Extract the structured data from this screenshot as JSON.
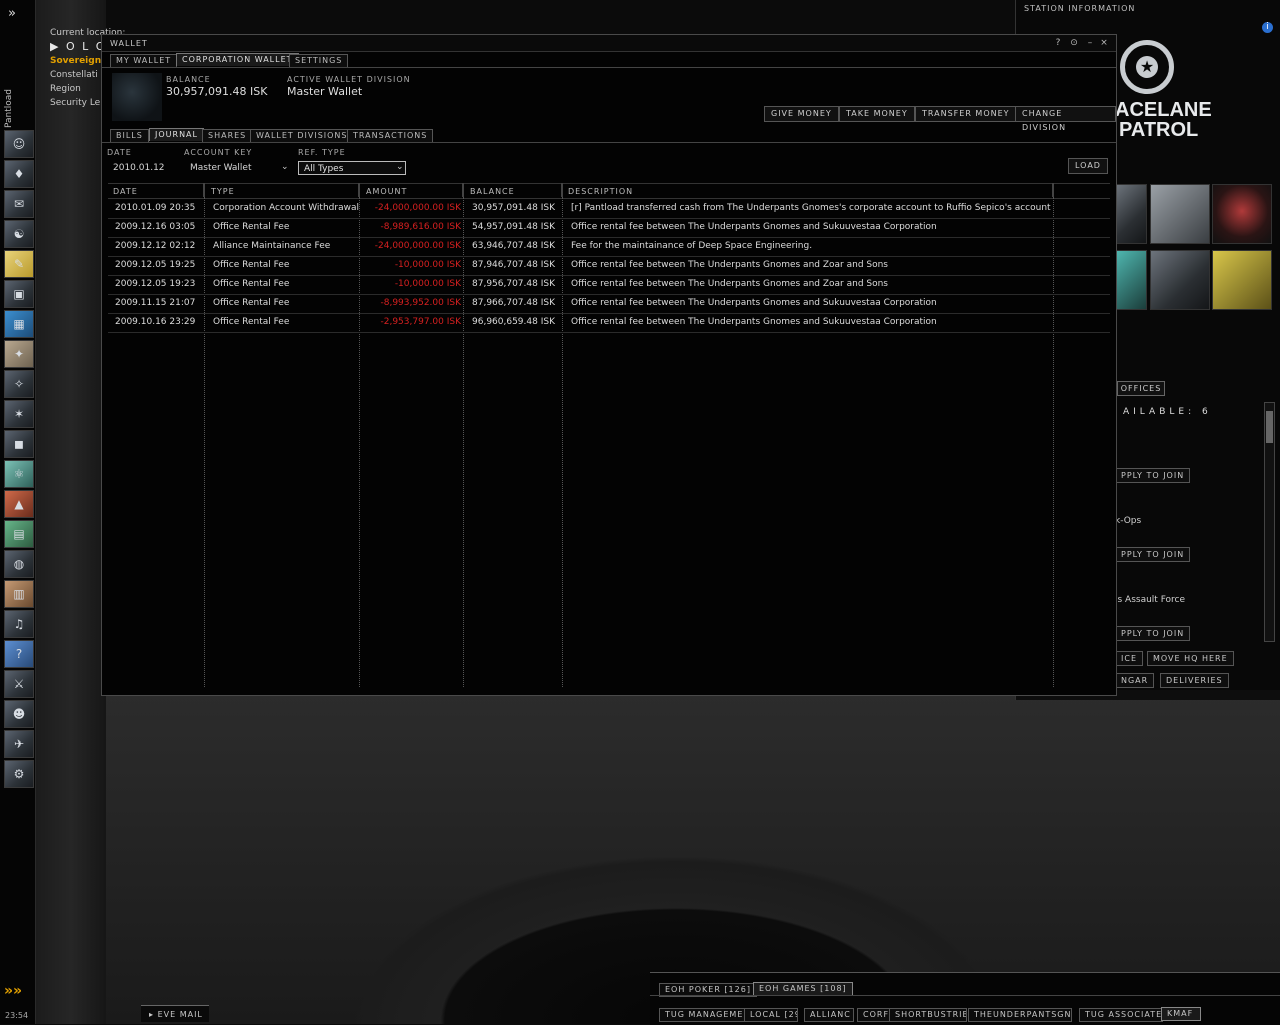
{
  "location": {
    "current_label": "Current location:",
    "system": "O L O –",
    "sovereignty": "Sovereign",
    "constellation": "Constellati",
    "region": "Region",
    "security": "Security Le"
  },
  "neocom": {
    "pilot": "Pantload",
    "clock": "23:54",
    "icons": [
      "character-sheet",
      "skills",
      "mail",
      "people",
      "notepad",
      "assets",
      "wallet",
      "map",
      "corporation",
      "market",
      "factions",
      "science",
      "fitting",
      "calculator",
      "journal",
      "contracts",
      "audio",
      "help",
      "medals",
      "agents",
      "ships",
      "items"
    ]
  },
  "wallet": {
    "title": "WALLET",
    "window_controls": [
      "?",
      "⊙",
      "–",
      "×"
    ],
    "tabs": [
      "MY WALLET",
      "CORPORATION WALLET",
      "SETTINGS"
    ],
    "active_tab": "CORPORATION WALLET",
    "balance_label": "BALANCE",
    "balance_value": "30,957,091.48 ISK",
    "division_label": "ACTIVE WALLET DIVISION",
    "division_value": "Master Wallet",
    "actions": [
      "GIVE MONEY",
      "TAKE MONEY",
      "TRANSFER MONEY",
      "CHANGE DIVISION"
    ],
    "subtabs": [
      "BILLS",
      "JOURNAL",
      "SHARES",
      "WALLET DIVISIONS",
      "TRANSACTIONS"
    ],
    "active_subtab": "JOURNAL",
    "filters": {
      "date_label": "DATE",
      "date_value": "2010.01.12",
      "account_label": "ACCOUNT KEY",
      "account_value": "Master Wallet",
      "reftype_label": "REF. TYPE",
      "reftype_value": "All Types",
      "load_label": "LOAD"
    },
    "columns": [
      "DATE",
      "TYPE",
      "AMOUNT",
      "BALANCE",
      "DESCRIPTION"
    ],
    "rows": [
      {
        "date": "2010.01.09 20:35",
        "type": "Corporation Account Withdrawal",
        "amount": "-24,000,000.00 ISK",
        "balance": "30,957,091.48 ISK",
        "description": "[r] Pantload transferred cash from The Underpants Gnomes's corporate account to Ruffio Sepico's account"
      },
      {
        "date": "2009.12.16 03:05",
        "type": "Office Rental Fee",
        "amount": "-8,989,616.00 ISK",
        "balance": "54,957,091.48 ISK",
        "description": "Office rental fee between The Underpants Gnomes and Sukuuvestaa Corporation"
      },
      {
        "date": "2009.12.12 02:12",
        "type": "Alliance Maintainance Fee",
        "amount": "-24,000,000.00 ISK",
        "balance": "63,946,707.48 ISK",
        "description": "Fee for the maintainance of Deep Space Engineering."
      },
      {
        "date": "2009.12.05 19:25",
        "type": "Office Rental Fee",
        "amount": "-10,000.00 ISK",
        "balance": "87,946,707.48 ISK",
        "description": "Office rental fee between The Underpants Gnomes and Zoar and Sons"
      },
      {
        "date": "2009.12.05 19:23",
        "type": "Office Rental Fee",
        "amount": "-10,000.00 ISK",
        "balance": "87,956,707.48 ISK",
        "description": "Office rental fee between The Underpants Gnomes and Zoar and Sons"
      },
      {
        "date": "2009.11.15 21:07",
        "type": "Office Rental Fee",
        "amount": "-8,993,952.00 ISK",
        "balance": "87,966,707.48 ISK",
        "description": "Office rental fee between The Underpants Gnomes and Sukuuvestaa Corporation"
      },
      {
        "date": "2009.10.16 23:29",
        "type": "Office Rental Fee",
        "amount": "-2,953,797.00 ISK",
        "balance": "96,960,659.48 ISK",
        "description": "Office rental fee between The Underpants Gnomes and Sukuuvestaa Corporation"
      }
    ]
  },
  "station": {
    "title": "STATION INFORMATION",
    "logo_line1": "ACELANE",
    "logo_line2": "PATROL",
    "offices_tab": "OFFICES",
    "available_label": "AILABLE:",
    "available_count": "6",
    "apply_label": "PPLY TO JOIN",
    "corp_entries": [
      "k-Ops",
      "ls Assault Force"
    ],
    "buttons": [
      "ICE",
      "MOVE HQ HERE",
      "NGAR",
      "DELIVERIES"
    ]
  },
  "chat": {
    "top_tabs": [
      "EOH POKER [126]",
      "EOH GAMES [108]"
    ],
    "bottom_tabs": [
      "TUG MANAGEMEN",
      "LOCAL [29",
      "ALLIANC",
      "CORF",
      "SHORTBUSTRIB",
      "THEUNDERPANTSGNOMI",
      "TUG ASSOCIATE",
      "KMAF"
    ],
    "eve_mail": "EVE MAIL"
  },
  "colors": {
    "negative": "#d52020",
    "accent": "#e2a000",
    "background": "#030303"
  }
}
